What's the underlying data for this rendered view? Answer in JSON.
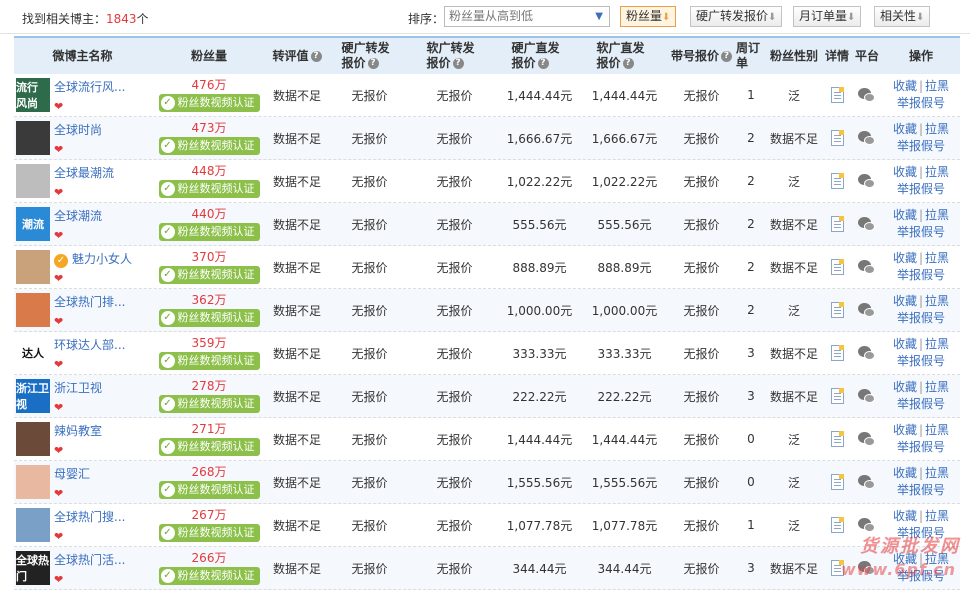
{
  "summary": {
    "prefix": "找到相关博主：",
    "count": "1843",
    "suffix": "个"
  },
  "sort": {
    "label": "排序：",
    "selected": "粉丝量从高到低",
    "buttons": [
      "粉丝量",
      "硬广转发报价",
      "月订单量",
      "相关性"
    ]
  },
  "columns": {
    "name": "微博主名称",
    "fans": "粉丝量",
    "zp": "转评值",
    "hz": "硬广转发报价",
    "rz": "软广转发报价",
    "hf": "硬广直发报价",
    "rf": "软广直发报价",
    "dh": "带号报价",
    "zd": "周订单",
    "xb": "粉丝性别",
    "xq": "详情",
    "pt": "平台",
    "op": "操作"
  },
  "verify_label": "粉丝数视频认证",
  "ops": {
    "collect": "收藏",
    "sep": "|",
    "block": "拉黑",
    "report": "举报假号"
  },
  "rows": [
    {
      "name": "全球流行风...",
      "fans": "476万",
      "zp": "数据不足",
      "hz": "无报价",
      "rz": "无报价",
      "hf": "1,444.44元",
      "rf": "1,444.44元",
      "dh": "无报价",
      "zd": "1",
      "xb": "泛",
      "avatar_text": "流行 风尚",
      "avatar_color": "#2d6b4a"
    },
    {
      "name": "全球时尚",
      "fans": "473万",
      "zp": "数据不足",
      "hz": "无报价",
      "rz": "无报价",
      "hf": "1,666.67元",
      "rf": "1,666.67元",
      "dh": "无报价",
      "zd": "2",
      "xb": "数据不足",
      "avatar_text": "",
      "avatar_color": "#3a3a3a"
    },
    {
      "name": "全球最潮流",
      "fans": "448万",
      "zp": "数据不足",
      "hz": "无报价",
      "rz": "无报价",
      "hf": "1,022.22元",
      "rf": "1,022.22元",
      "dh": "无报价",
      "zd": "2",
      "xb": "泛",
      "avatar_text": "",
      "avatar_color": "#bdbdbd"
    },
    {
      "name": "全球潮流",
      "fans": "440万",
      "zp": "数据不足",
      "hz": "无报价",
      "rz": "无报价",
      "hf": "555.56元",
      "rf": "555.56元",
      "dh": "无报价",
      "zd": "2",
      "xb": "数据不足",
      "avatar_text": "潮流",
      "avatar_color": "#2a8ad6"
    },
    {
      "name": "魅力小女人",
      "fans": "370万",
      "zp": "数据不足",
      "hz": "无报价",
      "rz": "无报价",
      "hf": "888.89元",
      "rf": "888.89元",
      "dh": "无报价",
      "zd": "2",
      "xb": "数据不足",
      "avatar_text": "",
      "avatar_color": "#c9a27c",
      "verified": true
    },
    {
      "name": "全球热门排...",
      "fans": "362万",
      "zp": "数据不足",
      "hz": "无报价",
      "rz": "无报价",
      "hf": "1,000.00元",
      "rf": "1,000.00元",
      "dh": "无报价",
      "zd": "2",
      "xb": "泛",
      "avatar_text": "",
      "avatar_color": "#d97a4a"
    },
    {
      "name": "环球达人部...",
      "fans": "359万",
      "zp": "数据不足",
      "hz": "无报价",
      "rz": "无报价",
      "hf": "333.33元",
      "rf": "333.33元",
      "dh": "无报价",
      "zd": "3",
      "xb": "数据不足",
      "avatar_text": "达人",
      "avatar_color": "#ffffff"
    },
    {
      "name": "浙江卫视",
      "fans": "278万",
      "zp": "数据不足",
      "hz": "无报价",
      "rz": "无报价",
      "hf": "222.22元",
      "rf": "222.22元",
      "dh": "无报价",
      "zd": "3",
      "xb": "数据不足",
      "avatar_text": "浙江卫视",
      "avatar_color": "#1a6fc4"
    },
    {
      "name": "辣妈教室",
      "fans": "271万",
      "zp": "数据不足",
      "hz": "无报价",
      "rz": "无报价",
      "hf": "1,444.44元",
      "rf": "1,444.44元",
      "dh": "无报价",
      "zd": "0",
      "xb": "泛",
      "avatar_text": "",
      "avatar_color": "#6b4a3a"
    },
    {
      "name": "母婴汇",
      "fans": "268万",
      "zp": "数据不足",
      "hz": "无报价",
      "rz": "无报价",
      "hf": "1,555.56元",
      "rf": "1,555.56元",
      "dh": "无报价",
      "zd": "0",
      "xb": "泛",
      "avatar_text": "",
      "avatar_color": "#e8b8a0"
    },
    {
      "name": "全球热门搜...",
      "fans": "267万",
      "zp": "数据不足",
      "hz": "无报价",
      "rz": "无报价",
      "hf": "1,077.78元",
      "rf": "1,077.78元",
      "dh": "无报价",
      "zd": "1",
      "xb": "泛",
      "avatar_text": "",
      "avatar_color": "#7aa0c8"
    },
    {
      "name": "全球热门活...",
      "fans": "266万",
      "zp": "数据不足",
      "hz": "无报价",
      "rz": "无报价",
      "hf": "344.44元",
      "rf": "344.44元",
      "dh": "无报价",
      "zd": "3",
      "xb": "数据不足",
      "avatar_text": "全球热门",
      "avatar_color": "#222222"
    }
  ],
  "watermark": {
    "line1": "货源批发网",
    "line2": "www.6pf.cn"
  }
}
